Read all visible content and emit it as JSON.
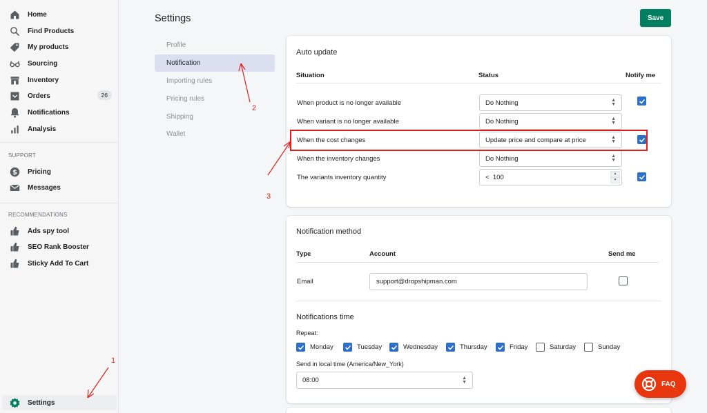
{
  "sidebar": {
    "main": [
      {
        "label": "Home",
        "icon": "home-icon"
      },
      {
        "label": "Find Products",
        "icon": "search-icon"
      },
      {
        "label": "My products",
        "icon": "tag-icon"
      },
      {
        "label": "Sourcing",
        "icon": "glasses-icon"
      },
      {
        "label": "Inventory",
        "icon": "store-icon"
      },
      {
        "label": "Orders",
        "icon": "orders-icon",
        "badge": "26"
      },
      {
        "label": "Notifications",
        "icon": "bell-icon"
      },
      {
        "label": "Analysis",
        "icon": "bar-chart-icon"
      }
    ],
    "support_title": "SUPPORT",
    "support": [
      {
        "label": "Pricing",
        "icon": "dollar-icon"
      },
      {
        "label": "Messages",
        "icon": "envelope-icon"
      }
    ],
    "recommendations_title": "RECOMMENDATIONS",
    "recommendations": [
      {
        "label": "Ads spy tool",
        "icon": "thumbs-up-icon"
      },
      {
        "label": "SEO Rank Booster",
        "icon": "thumbs-up-icon"
      },
      {
        "label": "Sticky Add To Cart",
        "icon": "thumbs-up-icon"
      }
    ],
    "settings_label": "Settings"
  },
  "page": {
    "title": "Settings",
    "save_label": "Save"
  },
  "submenu": [
    "Profile",
    "Notification",
    "Importing rules",
    "Pricing rules",
    "Shipping",
    "Wallet"
  ],
  "auto_update": {
    "title": "Auto update",
    "col_situation": "Situation",
    "col_status": "Status",
    "col_notify": "Notify me",
    "rows": [
      {
        "label": "When product is no longer available",
        "status": "Do Nothing",
        "notify": true
      },
      {
        "label": "When variant is no longer available",
        "status": "Do Nothing",
        "notify": false
      },
      {
        "label": "When the cost changes",
        "status": "Update price and compare at price",
        "notify": true
      },
      {
        "label": "When the inventory changes",
        "status": "Do Nothing",
        "notify": false
      },
      {
        "label": "The variants inventory quantity",
        "status": "<  100",
        "notify": true
      }
    ]
  },
  "notification_method": {
    "title": "Notification method",
    "col_type": "Type",
    "col_account": "Account",
    "col_send": "Send me",
    "type": "Email",
    "account": "support@dropshipman.com",
    "send_me": false
  },
  "notifications_time": {
    "title": "Notifications time",
    "repeat_label": "Repeat:",
    "days": [
      {
        "label": "Monday",
        "checked": true
      },
      {
        "label": "Tuesday",
        "checked": true
      },
      {
        "label": "Wednesday",
        "checked": true
      },
      {
        "label": "Thursday",
        "checked": true
      },
      {
        "label": "Friday",
        "checked": true
      },
      {
        "label": "Saturday",
        "checked": false
      },
      {
        "label": "Sunday",
        "checked": false
      }
    ],
    "local_time_label": "Send in local time (America/New_York)",
    "time": "08:00"
  },
  "annotations": {
    "one": "1",
    "two": "2",
    "three": "3"
  },
  "faq_label": "FAQ",
  "colors": {
    "accent": "#008060",
    "checkbox": "#2c6ecb",
    "annotation": "#e0201a",
    "faq": "#e8360f"
  }
}
